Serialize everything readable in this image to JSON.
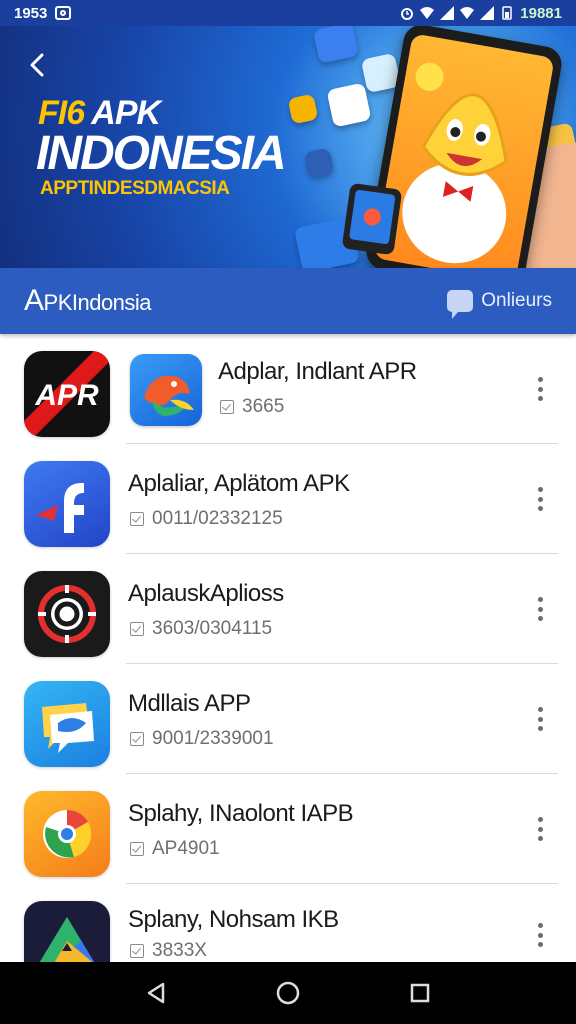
{
  "status_bar": {
    "time": "1953",
    "right_time": "19881"
  },
  "hero": {
    "title_line1_prefix": "FI6",
    "title_line1_suffix": " APK",
    "title_line2": "INDONESIA",
    "subtitle": "APPTINDESDMACSIA"
  },
  "app_bar": {
    "title_first": "A",
    "title_rest": "PKIndonsia",
    "action_label": "Onlieurs"
  },
  "apps": [
    {
      "title": "Adplar, Indlant APR",
      "meta": "3665",
      "icon": "apr-icon"
    },
    {
      "title": "Aplaliar, Aplätom APK",
      "meta": "0011/02332125",
      "icon": "f-letter-icon"
    },
    {
      "title": "AplauskAplioss",
      "meta": "3603/0304115",
      "icon": "target-icon"
    },
    {
      "title": "Mdllais APP",
      "meta": "9001/2339001",
      "icon": "chat-bubble-icon"
    },
    {
      "title": "Splahy, INaolont IAPB",
      "meta": "AP4901",
      "icon": "chrome-like-icon"
    },
    {
      "title": "Splany, Nohsam IKB",
      "meta": "3833X",
      "icon": "drive-like-icon"
    }
  ],
  "colors": {
    "status_bar": "#1a3f9e",
    "app_bar": "#2d5cc0",
    "accent_yellow": "#ffc400",
    "navbar": "#000000"
  }
}
